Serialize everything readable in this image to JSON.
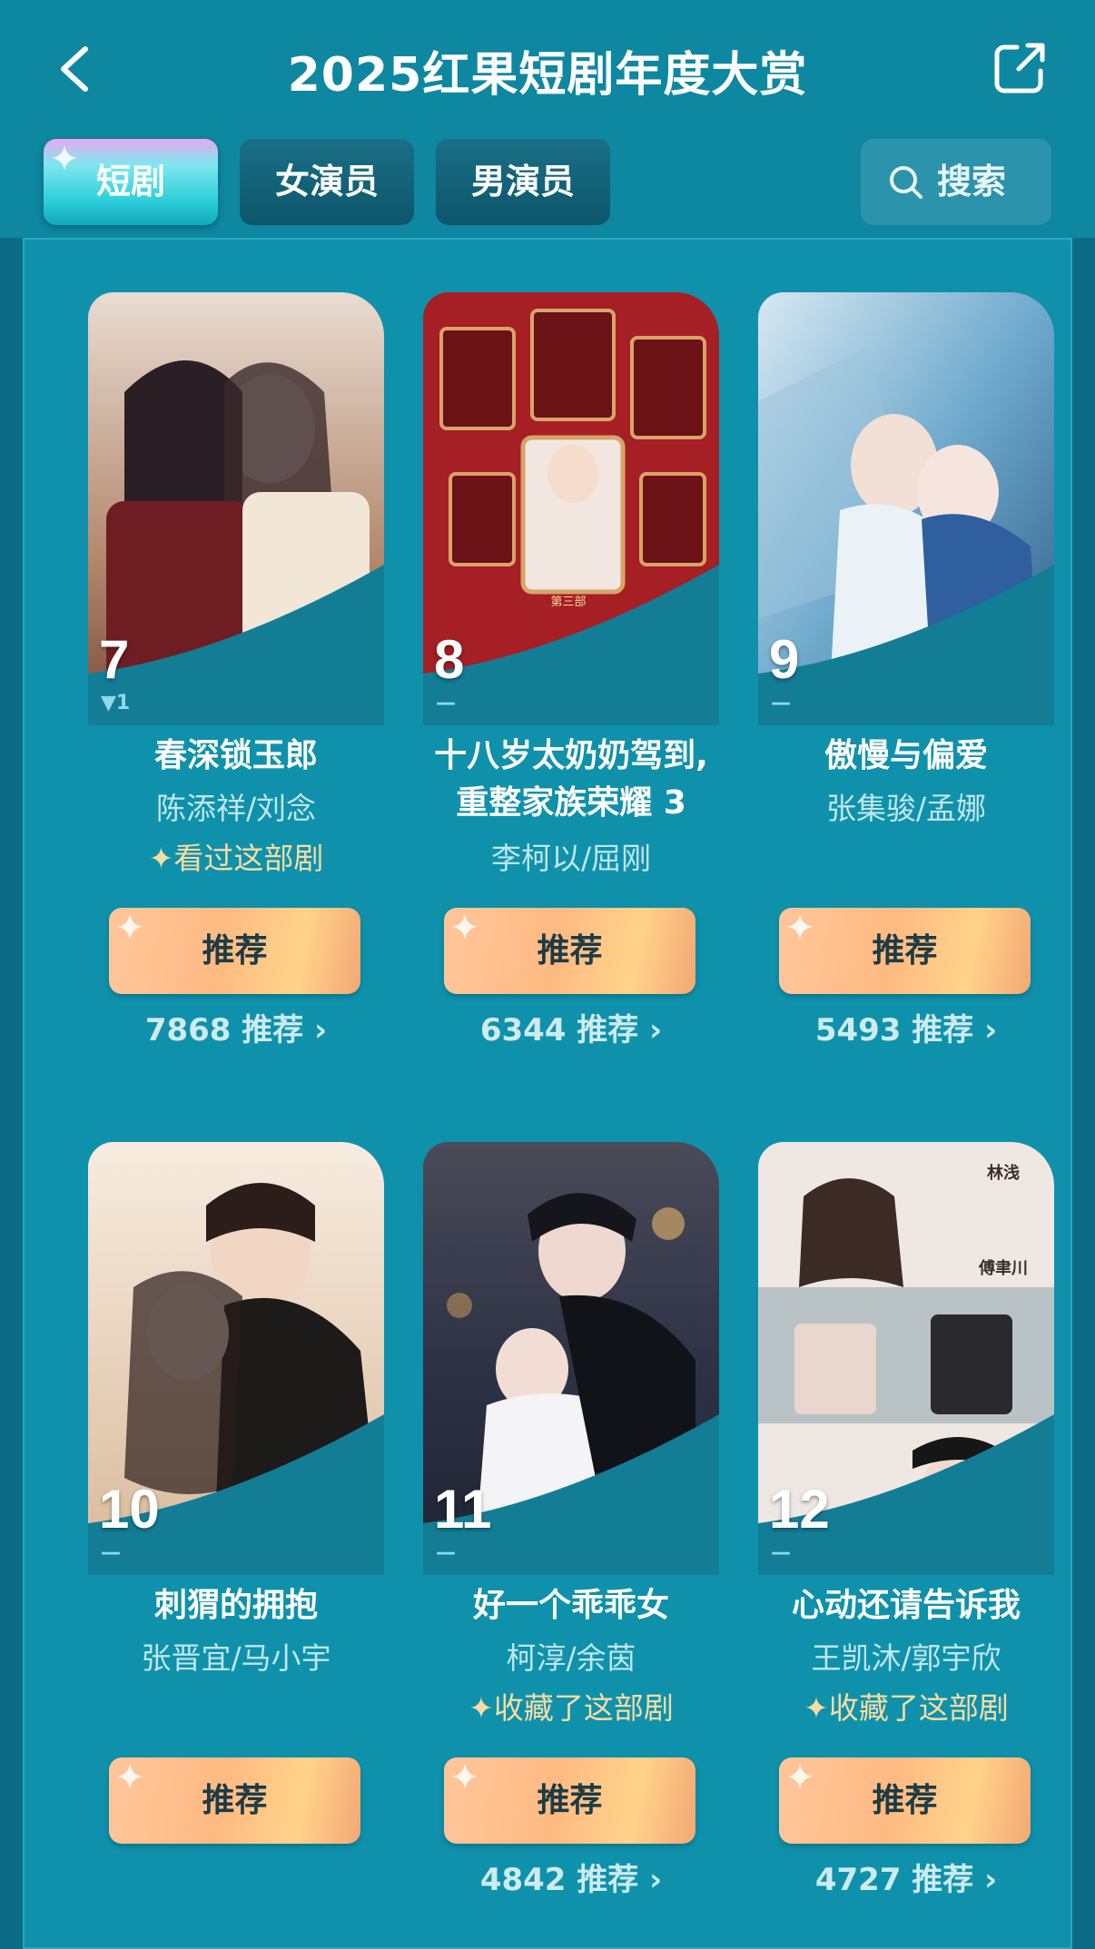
{
  "header": {
    "title": "2025红果短剧年度大赏",
    "tabs": [
      {
        "label": "短剧",
        "active": true
      },
      {
        "label": "女演员",
        "active": false
      },
      {
        "label": "男演员",
        "active": false
      }
    ],
    "search_label": "搜索"
  },
  "colors": {
    "header_bg": "#0e87a1",
    "panel_bg": "#0f91ab",
    "button_gradient": "#ffba82",
    "watched_text": "#f7dca2"
  },
  "dramas": [
    {
      "rank": "7",
      "trend": "▼1",
      "title": "春深锁玉郎",
      "poster_text": "春深锁玉郎",
      "cast": "陈添祥/刘念",
      "status": "✦看过这部剧",
      "button": "推荐",
      "count": "7868 推荐 ›"
    },
    {
      "rank": "8",
      "trend": "—",
      "title_line1": "十八岁太奶奶驾到,",
      "title_line2": "重整家族荣耀 3",
      "poster_text": "十八岁太奶奶驾到 重整家族荣耀",
      "poster_sub": "第三部",
      "cast": "李柯以/屈刚",
      "button": "推荐",
      "count": "6344 推荐 ›"
    },
    {
      "rank": "9",
      "trend": "—",
      "title": "傲慢与偏爱",
      "poster_text": "傲慢与偏爱",
      "cast": "张集骏/孟娜",
      "button": "推荐",
      "count": "5493 推荐 ›"
    },
    {
      "rank": "10",
      "trend": "—",
      "title": "刺猬的拥抱",
      "poster_text": "刺猬的拥抱",
      "cast": "张晋宜/马小宇",
      "button": "推荐"
    },
    {
      "rank": "11",
      "trend": "—",
      "title": "好一个乖乖女",
      "poster_text": "好一个乖乖女",
      "cast": "柯淳/余茵",
      "status": "✦收藏了这部剧",
      "button": "推荐",
      "count": "4842 推荐 ›"
    },
    {
      "rank": "12",
      "trend": "—",
      "title": "心动还请告诉我",
      "poster_text": "心动还请告诉我",
      "poster_names": [
        "林浅",
        "傅聿川"
      ],
      "cast": "王凯沐/郭宇欣",
      "status": "✦收藏了这部剧",
      "button": "推荐",
      "count": "4727 推荐 ›"
    }
  ]
}
